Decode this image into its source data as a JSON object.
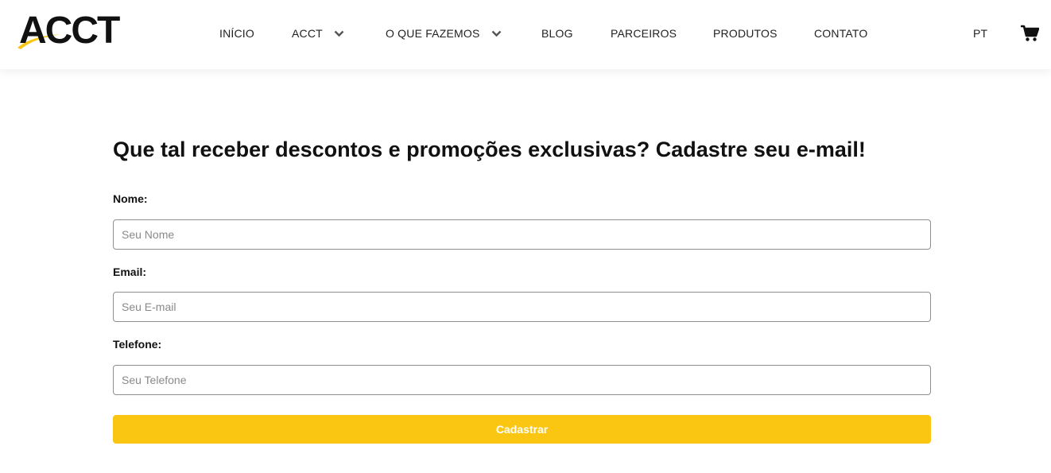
{
  "brand": {
    "logo_text": "ACCT",
    "accent_color": "#fbc612",
    "text_color": "#111111"
  },
  "nav": {
    "items": [
      {
        "label": "INÍCIO",
        "has_dropdown": false
      },
      {
        "label": "ACCT",
        "has_dropdown": true
      },
      {
        "label": "O QUE FAZEMOS",
        "has_dropdown": true
      },
      {
        "label": "BLOG",
        "has_dropdown": false
      },
      {
        "label": "PARCEIROS",
        "has_dropdown": false
      },
      {
        "label": "PRODUTOS",
        "has_dropdown": false
      },
      {
        "label": "CONTATO",
        "has_dropdown": false
      }
    ],
    "language": "PT",
    "cart_icon": "shopping-cart-icon",
    "dropdown_icon": "chevron-down-icon"
  },
  "form": {
    "title": "Que tal receber descontos e promoções exclusivas? Cadastre seu e-mail!",
    "fields": [
      {
        "label": "Nome:",
        "placeholder": "Seu Nome",
        "value": ""
      },
      {
        "label": "Email:",
        "placeholder": "Seu E-mail",
        "value": ""
      },
      {
        "label": "Telefone:",
        "placeholder": "Seu Telefone",
        "value": ""
      }
    ],
    "submit_label": "Cadastrar"
  }
}
